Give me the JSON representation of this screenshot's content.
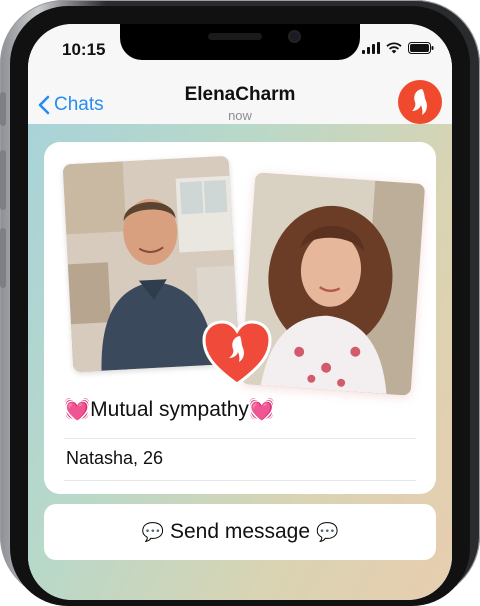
{
  "status": {
    "time": "10:15"
  },
  "header": {
    "back_label": "Chats",
    "title": "ElenaCharm",
    "subtitle": "now"
  },
  "match_card": {
    "title": "Mutual sympathy",
    "name_age": "Natasha, 26"
  },
  "action": {
    "send_label": "Send message"
  },
  "colors": {
    "accent_blue": "#2a8cf0",
    "brand_red": "#f04a2e"
  },
  "icons": [
    "back-chevron-icon",
    "signal-icon",
    "wifi-icon",
    "battery-icon",
    "brand-logo-icon",
    "heart-icon",
    "speech-bubble-icon"
  ]
}
